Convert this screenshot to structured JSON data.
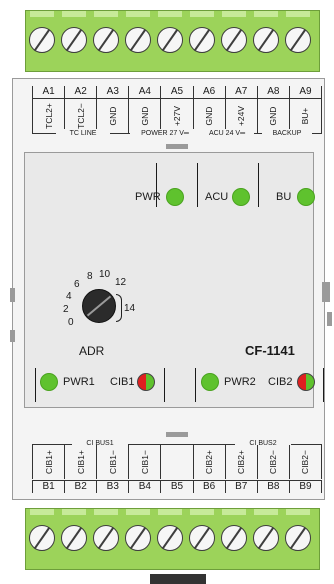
{
  "top_terminals": {
    "codes": [
      "A1",
      "A2",
      "A3",
      "A4",
      "A5",
      "A6",
      "A7",
      "A8",
      "A9"
    ],
    "signals": [
      "TCL2+",
      "TCL2−",
      "GND",
      "GND",
      "+27V",
      "GND",
      "+24V",
      "GND",
      "BU+"
    ],
    "groups": [
      "TC LINE",
      "POWER 27 V═",
      "ACU 24 V═",
      "BACKUP"
    ]
  },
  "leds": {
    "pwr": "PWR",
    "acu": "ACU",
    "bu": "BU",
    "pwr1": "PWR1",
    "cib1": "CIB1",
    "pwr2": "PWR2",
    "cib2": "CIB2"
  },
  "address_switch": {
    "label": "ADR",
    "scale": [
      "0",
      "2",
      "4",
      "6",
      "8",
      "10",
      "12",
      "14"
    ]
  },
  "model": "CF-1141",
  "bottom_terminals": {
    "groups": [
      "CI BUS1",
      "CI BUS2"
    ],
    "signals": [
      "CIB1+",
      "CIB1+",
      "CIB1−",
      "CIB1−",
      "",
      "CIB2+",
      "CIB2+",
      "CIB2−",
      "CIB2−"
    ],
    "codes": [
      "B1",
      "B2",
      "B3",
      "B4",
      "B5",
      "B6",
      "B7",
      "B8",
      "B9"
    ]
  },
  "colors": {
    "terminal_green": "#9cd35a",
    "led_green": "#5fc22e",
    "led_red": "#e02020"
  }
}
